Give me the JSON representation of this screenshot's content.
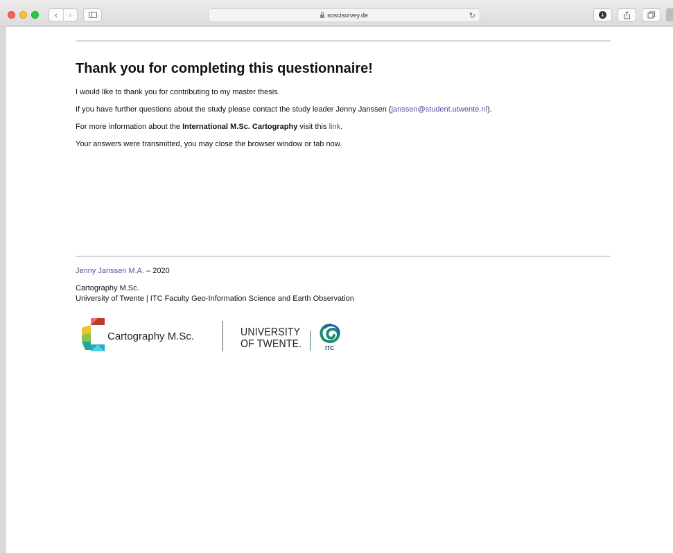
{
  "browser": {
    "url": "soscisurvey.de",
    "back_glyph": "‹",
    "forward_glyph": "›",
    "reload_glyph": "↻",
    "icons": [
      "sidebar-icon",
      "lock-icon",
      "reload-icon",
      "download-icon",
      "share-icon",
      "tabs-icon"
    ]
  },
  "main": {
    "title": "Thank you for completing this questionnaire!",
    "p1": "I would like to thank you for contributing to my master thesis.",
    "p2_prefix": "If you have further questions about the study please contact the study leader Jenny Janssen (",
    "p2_email": "janssen@student.utwente.nl",
    "p2_suffix": ").",
    "p3_prefix": "For more information about the ",
    "p3_bold": "International M.Sc. Cartography",
    "p3_middle": " visit this ",
    "p3_link": "link",
    "p3_suffix": ".",
    "p4": "Your answers were transmitted, you may close the browser window or tab now."
  },
  "footer": {
    "author_link": "Jenny Janssen M.A.",
    "year_text": " – 2020",
    "line1": "Cartography M.Sc.",
    "line2": "University of Twente | ITC Faculty Geo-Information Science and Earth Observation"
  },
  "logos": {
    "cartography": "Cartography M.Sc.",
    "ut_line1": "UNIVERSITY",
    "ut_line2": "OF TWENTE.",
    "itc": "ITC"
  },
  "colors": {
    "link": "#4d4fa0",
    "itc_green": "#1e8a6e",
    "itc_blue": "#1f5fa8"
  }
}
